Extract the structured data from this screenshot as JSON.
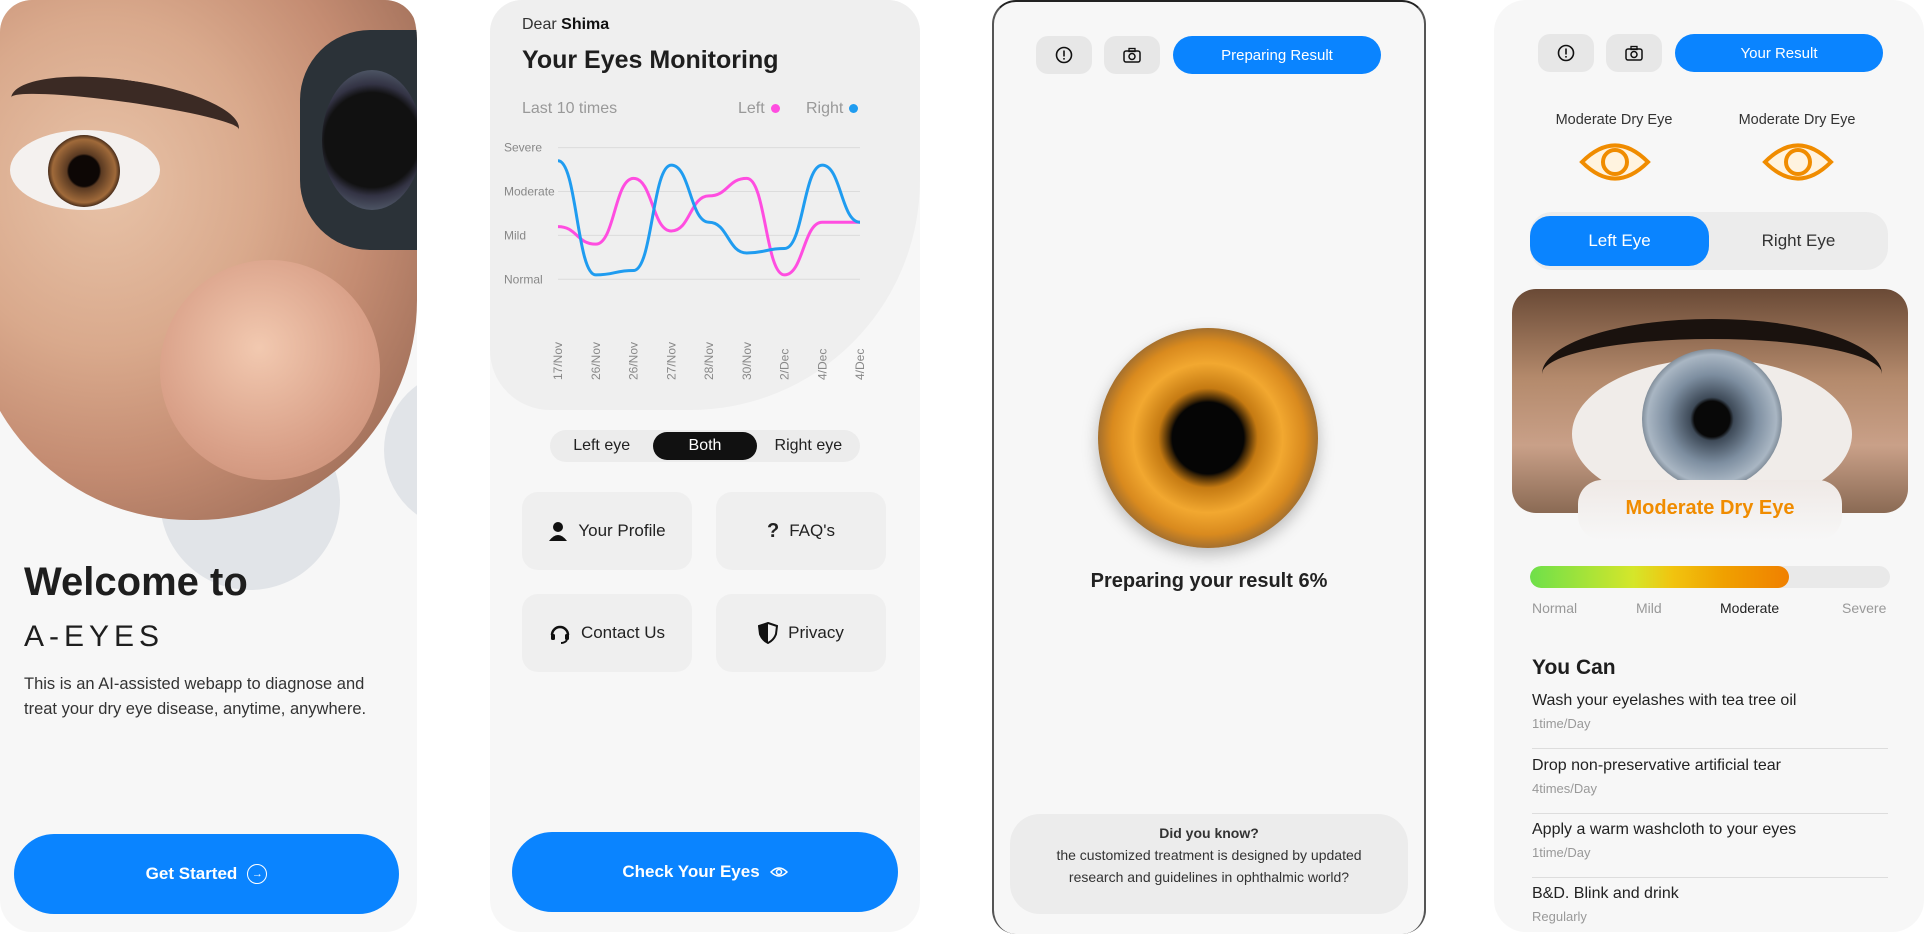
{
  "welcome": {
    "heading": "Welcome to",
    "brand": "A-EYES",
    "description": "This is an AI-assisted webapp to diagnose and treat your dry eye disease, anytime, anywhere.",
    "cta": "Get Started"
  },
  "monitoring": {
    "greeting_prefix": "Dear",
    "user_name": "Shima",
    "title": "Your Eyes Monitoring",
    "period": "Last 10 times",
    "legend": [
      {
        "label": "Left",
        "color": "#ff4de0"
      },
      {
        "label": "Right",
        "color": "#1f9cf0"
      }
    ],
    "segmented": [
      "Left eye",
      "Both",
      "Right eye"
    ],
    "segmented_selected": "Both",
    "tiles": {
      "profile": "Your Profile",
      "faq": "FAQ's",
      "contact": "Contact Us",
      "privacy": "Privacy"
    },
    "cta": "Check Your Eyes"
  },
  "chart_data": {
    "type": "line",
    "x": [
      "17/Nov",
      "26/Nov",
      "26/Nov",
      "27/Nov",
      "28/Nov",
      "30/Nov",
      "2/Dec",
      "4/Dec",
      "4/Dec"
    ],
    "y_categories": [
      "Normal",
      "Mild",
      "Moderate",
      "Severe"
    ],
    "series": [
      {
        "name": "Left",
        "color": "#ff4de0",
        "values": [
          1.9,
          1.5,
          3.0,
          1.8,
          2.6,
          3.0,
          0.8,
          2.0,
          2.0
        ]
      },
      {
        "name": "Right",
        "color": "#1f9cf0",
        "values": [
          3.4,
          0.8,
          0.9,
          3.3,
          2.0,
          1.3,
          1.4,
          3.3,
          2.0
        ]
      }
    ]
  },
  "processing": {
    "button": "Preparing Result",
    "progress_text": "Preparing your result 6%",
    "progress": 6,
    "tip_title": "Did you know?",
    "tip_text": "the customized treatment is designed by updated research and guidelines in ophthalmic world?"
  },
  "result": {
    "button": "Your Result",
    "left_label": "Moderate Dry Eye",
    "right_label": "Moderate Dry Eye",
    "tabs": [
      "Left Eye",
      "Right Eye"
    ],
    "selected_tab": "Left Eye",
    "severity": "Moderate Dry Eye",
    "severity_level": 0.72,
    "scale": [
      "Normal",
      "Mild",
      "Moderate",
      "Severe"
    ],
    "scale_current": "Moderate",
    "you_can_title": "You Can",
    "recommendations": [
      {
        "title": "Wash your eyelashes with tea tree oil",
        "freq": "1time/Day"
      },
      {
        "title": "Drop non-preservative artificial tear",
        "freq": "4times/Day"
      },
      {
        "title": "Apply a warm washcloth to your eyes",
        "freq": "1time/Day"
      },
      {
        "title": "B&D. Blink and drink",
        "freq": "Regularly"
      }
    ]
  },
  "colors": {
    "accent": "#0a84ff",
    "warning": "#f08c00"
  }
}
